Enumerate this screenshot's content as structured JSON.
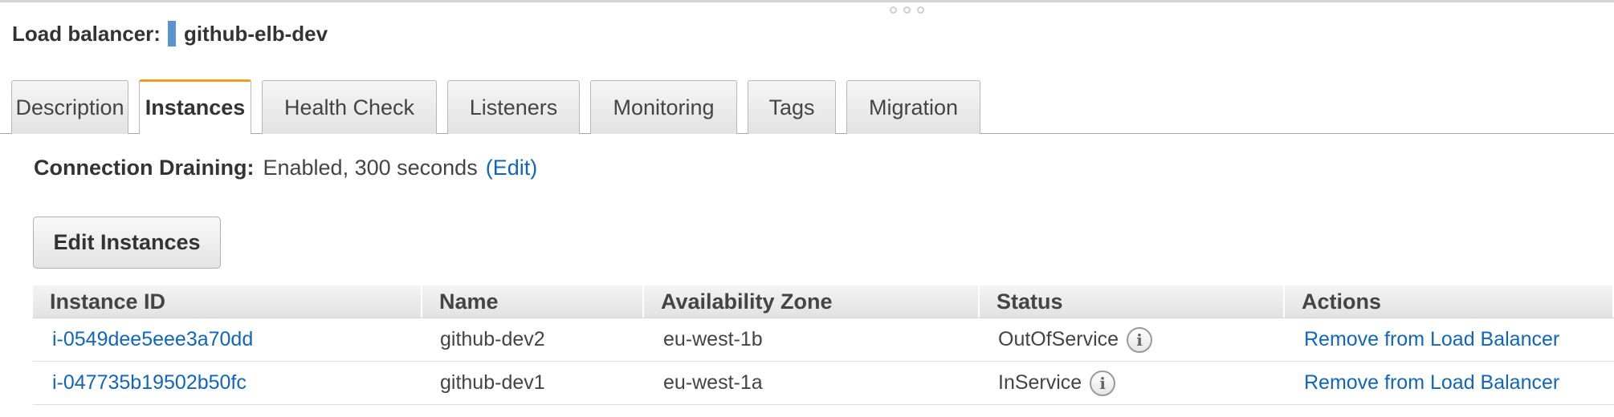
{
  "header": {
    "label": "Load balancer:",
    "name": "github-elb-dev"
  },
  "tabs": [
    {
      "label": "Description",
      "active": false
    },
    {
      "label": "Instances",
      "active": true
    },
    {
      "label": "Health Check",
      "active": false
    },
    {
      "label": "Listeners",
      "active": false
    },
    {
      "label": "Monitoring",
      "active": false
    },
    {
      "label": "Tags",
      "active": false
    },
    {
      "label": "Migration",
      "active": false
    }
  ],
  "connection_draining": {
    "label": "Connection Draining:",
    "value": "Enabled, 300 seconds",
    "edit_label": "(Edit)"
  },
  "edit_instances_label": "Edit Instances",
  "table": {
    "columns": [
      "Instance ID",
      "Name",
      "Availability Zone",
      "Status",
      "Actions"
    ],
    "rows": [
      {
        "instance_id": "i-0549dee5eee3a70dd",
        "name": "github-dev2",
        "zone": "eu-west-1b",
        "status": "OutOfService",
        "action": "Remove from Load Balancer"
      },
      {
        "instance_id": "i-047735b19502b50fc",
        "name": "github-dev1",
        "zone": "eu-west-1a",
        "status": "InService",
        "action": "Remove from Load Balancer"
      }
    ]
  },
  "icons": {
    "info": "info-icon",
    "info_glyph": "i"
  },
  "colors": {
    "link": "#1166bb",
    "active_tab_accent": "#f39c23",
    "lb_marker": "#5a93cf"
  }
}
